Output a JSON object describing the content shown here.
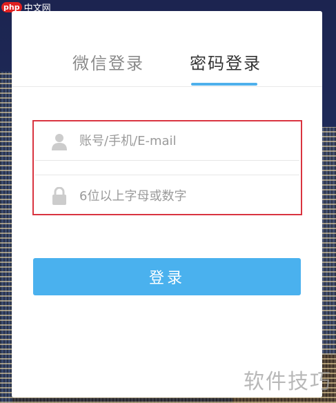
{
  "tabs": [
    {
      "label": "微信登录",
      "active": false
    },
    {
      "label": "密码登录",
      "active": true
    }
  ],
  "form": {
    "username_placeholder": "账号/手机/E-mail",
    "username_icon": "user-icon",
    "password_placeholder": "6位以上字母或数字",
    "password_icon": "lock-icon"
  },
  "login_button": "登录",
  "watermark_top": {
    "logo": "php",
    "text": "中文网"
  },
  "watermark_bottom": "软件技巧",
  "colors": {
    "accent": "#4ab1ee",
    "highlight_box": "#d9333f",
    "icon": "#cccccc"
  }
}
